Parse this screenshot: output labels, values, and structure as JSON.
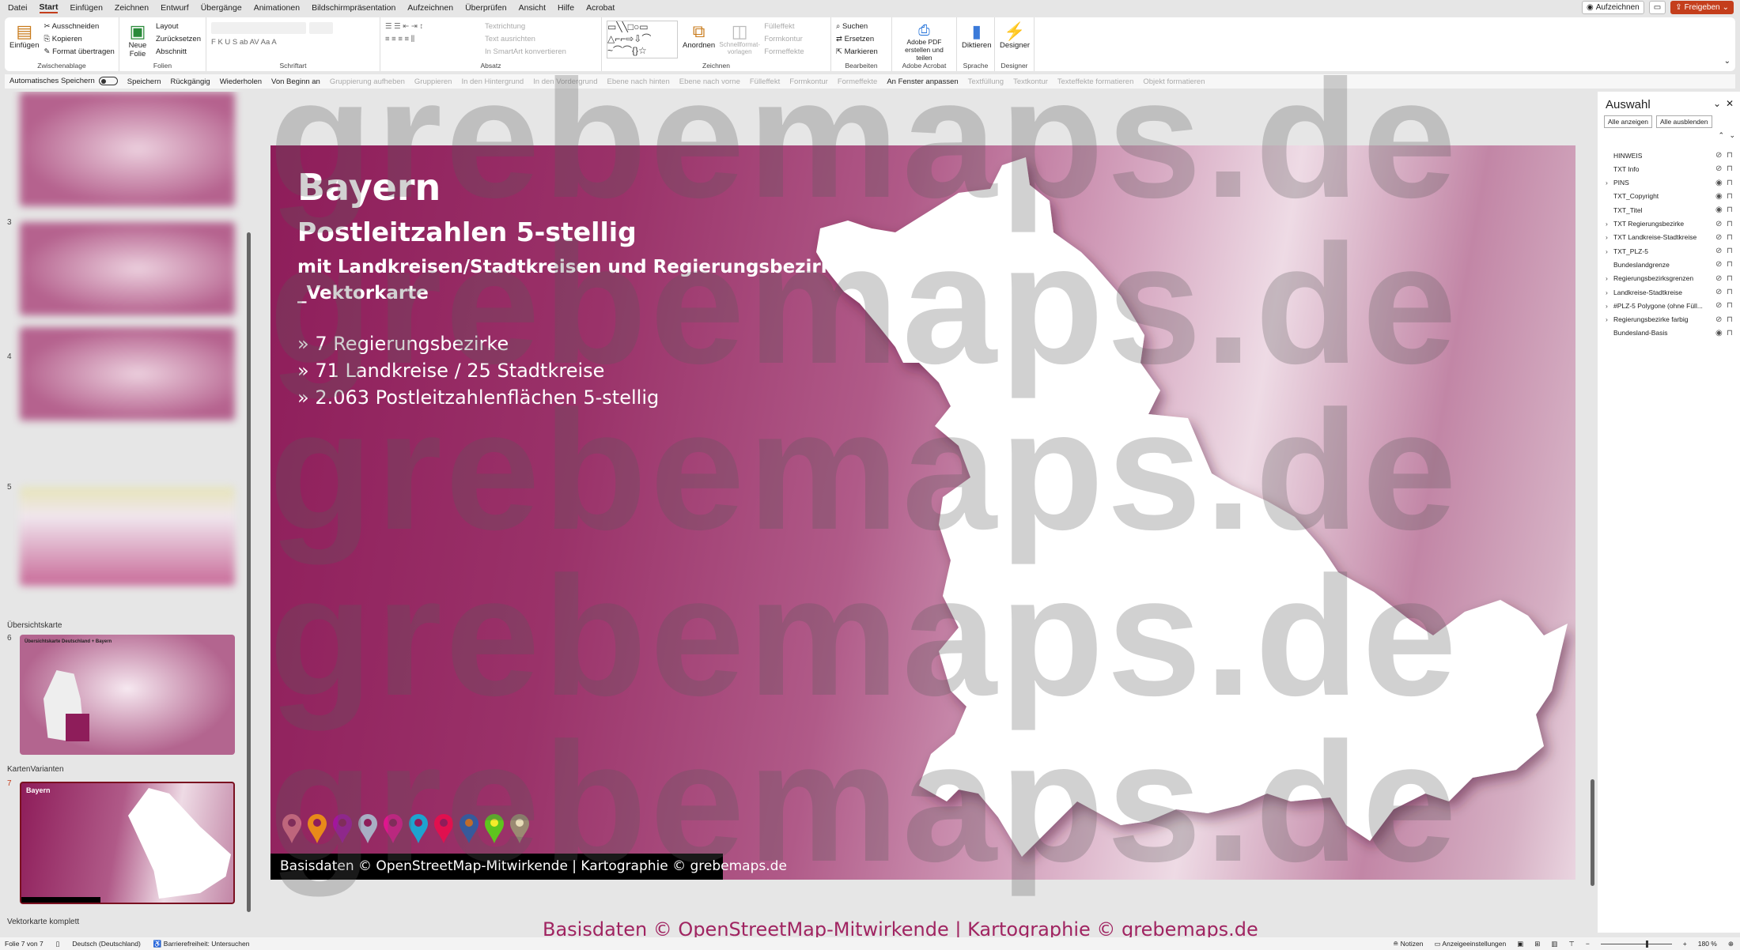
{
  "menu": {
    "tabs": [
      "Datei",
      "Start",
      "Einfügen",
      "Zeichnen",
      "Entwurf",
      "Übergänge",
      "Animationen",
      "Bildschirmpräsentation",
      "Aufzeichnen",
      "Überprüfen",
      "Ansicht",
      "Hilfe",
      "Acrobat"
    ],
    "active": "Start"
  },
  "topright": {
    "record": "Aufzeichnen",
    "share": "Freigeben"
  },
  "ribbon": {
    "clipboard": {
      "paste": "Einfügen",
      "cut": "Ausschneiden",
      "copy": "Kopieren",
      "format": "Format übertragen",
      "label": "Zwischenablage"
    },
    "slides": {
      "new": "Neue Folie",
      "layout": "Layout",
      "reset": "Zurücksetzen",
      "section": "Abschnitt",
      "label": "Folien"
    },
    "font": {
      "label": "Schriftart",
      "buttons": "F  K  U  S  ab  AV  Aa  A"
    },
    "paragraph": {
      "direction": "Textrichtung",
      "align": "Text ausrichten",
      "smartart": "In SmartArt konvertieren",
      "label": "Absatz"
    },
    "drawing": {
      "arrange": "Anordnen",
      "quickstyles": "Schnellformat-vorlagen",
      "fill": "Fülleffekt",
      "outline": "Formkontur",
      "effects": "Formeffekte",
      "label": "Zeichnen"
    },
    "editing": {
      "find": "Suchen",
      "replace": "Ersetzen",
      "select": "Markieren",
      "label": "Bearbeiten"
    },
    "acrobat": {
      "pdf": "Adobe PDF erstellen und teilen",
      "label": "Adobe Acrobat"
    },
    "voice": {
      "dictate": "Diktieren",
      "label": "Sprache"
    },
    "designer": {
      "designer": "Designer",
      "label": "Designer"
    }
  },
  "qat": {
    "items": [
      "Automatisches Speichern",
      "Speichern",
      "Rückgängig",
      "Wiederholen",
      "Von Beginn an",
      "Gruppierung aufheben",
      "Gruppieren",
      "In den Hintergrund",
      "In den Vordergrund",
      "Ebene nach hinten",
      "Ebene nach vorne",
      "Fülleffekt",
      "Formkontur",
      "Formeffekte",
      "An Fenster anpassen",
      "Textfüllung",
      "Textkontur",
      "Texteffekte formatieren",
      "Objekt formatieren"
    ]
  },
  "thumbs": {
    "numbers": [
      "3",
      "4",
      "5",
      "6",
      "7"
    ],
    "sections": [
      "Übersichtskarte",
      "KartenVarianten",
      "Vektorkarte komplett"
    ],
    "slide6_title": "Übersichtskarte Deutschland + Bayern",
    "slide7_title": "Bayern"
  },
  "slide": {
    "title": "Bayern",
    "subtitle": "Postleitzahlen 5-stellig",
    "line3": "mit Landkreisen/Stadtkreisen und Regierungsbezirken",
    "line4": "_Vektorkarte",
    "bullets": [
      "» 7 Regierungsbezirke",
      "» 71 Landkreise / 25 Stadtkreise",
      "» 2.063 Postleitzahlenflächen 5-stellig"
    ],
    "copyright": "Basisdaten © OpenStreetMap-Mitwirkende | Kartographie © grebemaps.de",
    "pin_colors": [
      "#e56b8a",
      "#e88a1a",
      "#a3159e",
      "#a8aec4",
      "#e0158e",
      "#1ea3cf",
      "#e0104f",
      "#2a5bb5",
      "#5ec41e",
      "#9a8a72"
    ],
    "pin_dots": [
      "#8e1d5a",
      "#8e1d5a",
      "#8e1d5a",
      "#8e1d5a",
      "#8e1d5a",
      "#8e1d5a",
      "#8e1d5a",
      "#e8731a",
      "#f4ec2a",
      "#e8dcb8"
    ]
  },
  "watermark": "grebemaps.de",
  "selection": {
    "title": "Auswahl",
    "show_all": "Alle anzeigen",
    "hide_all": "Alle ausblenden",
    "items": [
      {
        "label": "HINWEIS",
        "expand": false,
        "visible": false
      },
      {
        "label": "TXT Info",
        "expand": false,
        "visible": false
      },
      {
        "label": "PINS",
        "expand": true,
        "visible": true
      },
      {
        "label": "TXT_Copyright",
        "expand": false,
        "visible": true
      },
      {
        "label": "TXT_Titel",
        "expand": false,
        "visible": true
      },
      {
        "label": "TXT Regierungsbezirke",
        "expand": true,
        "visible": false
      },
      {
        "label": "TXT Landkreise-Stadtkreise",
        "expand": true,
        "visible": false
      },
      {
        "label": "TXT_PLZ-5",
        "expand": true,
        "visible": false
      },
      {
        "label": "Bundeslandgrenze",
        "expand": false,
        "visible": false
      },
      {
        "label": "Regierungsbezirksgrenzen",
        "expand": true,
        "visible": false
      },
      {
        "label": "Landkreise-Stadtkreise",
        "expand": true,
        "visible": false
      },
      {
        "label": "#PLZ-5 Polygone (ohne Füll...",
        "expand": true,
        "visible": false
      },
      {
        "label": "Regierungsbezirke farbig",
        "expand": true,
        "visible": false
      },
      {
        "label": "Bundesland-Basis",
        "expand": false,
        "visible": true
      }
    ]
  },
  "bottom_watermark": "Basisdaten © OpenStreetMap-Mitwirkende | Kartographie © grebemaps.de",
  "status": {
    "slide": "Folie 7 von 7",
    "language": "Deutsch (Deutschland)",
    "accessibility": "Barrierefreiheit: Untersuchen",
    "notes": "Notizen",
    "display": "Anzeigeeinstellungen",
    "zoom": "180 %",
    "zoom_percent": 180
  }
}
